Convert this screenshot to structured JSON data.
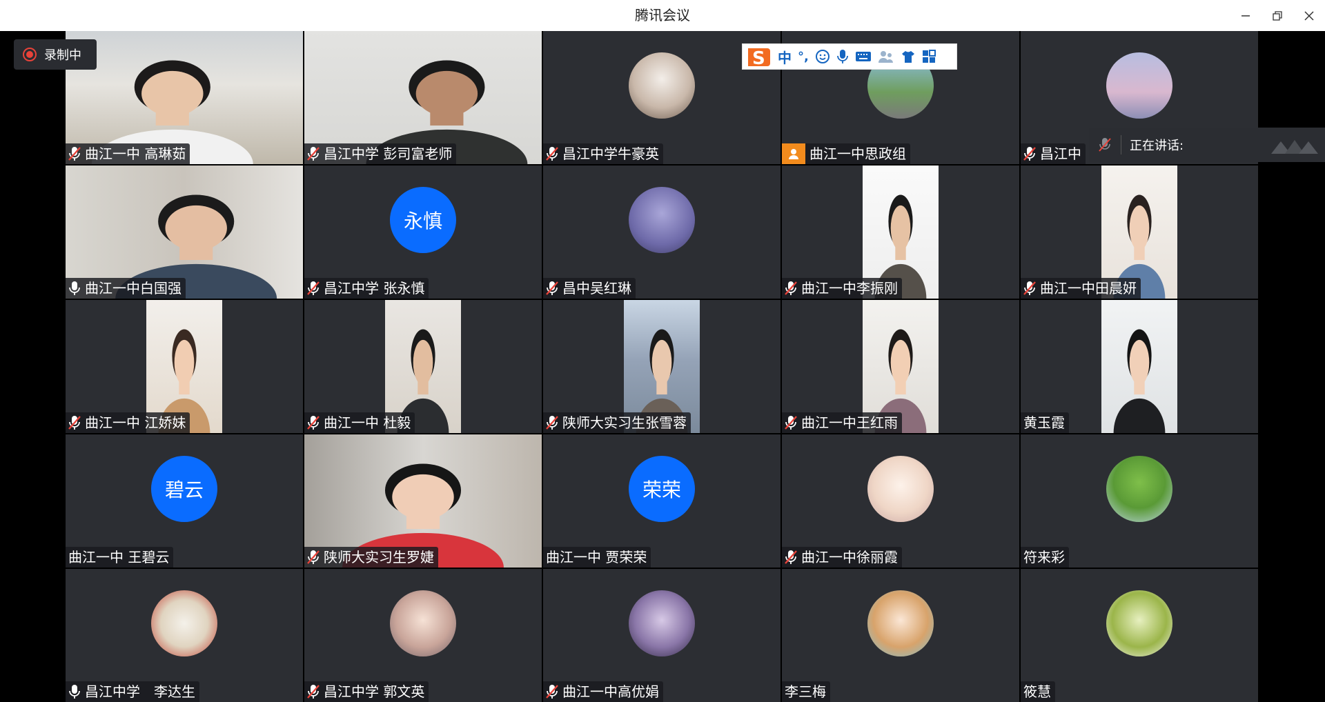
{
  "app": {
    "title": "腾讯会议"
  },
  "recording": {
    "label": "录制中"
  },
  "speaking": {
    "label": "正在讲话:"
  },
  "ime_toolbar": {
    "mode": "中",
    "punct": "°,"
  },
  "colors": {
    "tile_bg": "#2c2e33",
    "avatar_blue": "#0a6cff",
    "rec_red": "#e8433a"
  },
  "participants": [
    {
      "name": "曲江一中 高琳茹",
      "mic": "muted",
      "media": "video"
    },
    {
      "name": "昌江中学 彭司富老师",
      "mic": "muted",
      "media": "video"
    },
    {
      "name": "昌江中学牛豪英",
      "mic": "muted",
      "media": "avatar-image"
    },
    {
      "name": "曲江一中思政组",
      "mic": "person",
      "media": "avatar-image"
    },
    {
      "name": "昌江中",
      "mic": "muted",
      "media": "avatar-image"
    },
    {
      "name": "曲江一中白国强",
      "mic": "on",
      "media": "video"
    },
    {
      "name": "昌江中学 张永慎",
      "mic": "muted",
      "media": "avatar-text",
      "avatar_text": "永慎"
    },
    {
      "name": "昌中吴红琳",
      "mic": "muted",
      "media": "avatar-image"
    },
    {
      "name": "曲江一中李振刚",
      "mic": "muted",
      "media": "video"
    },
    {
      "name": "曲江一中田晨妍",
      "mic": "muted",
      "media": "video"
    },
    {
      "name": "曲江一中 江娇妹",
      "mic": "muted",
      "media": "video"
    },
    {
      "name": "曲江一中 杜毅",
      "mic": "muted",
      "media": "video"
    },
    {
      "name": "陕师大实习生张雪蓉",
      "mic": "muted",
      "media": "video"
    },
    {
      "name": "曲江一中王红雨",
      "mic": "muted",
      "media": "video"
    },
    {
      "name": "黄玉霞",
      "mic": "none",
      "media": "video"
    },
    {
      "name": "曲江一中 王碧云",
      "mic": "none",
      "media": "avatar-text",
      "avatar_text": "碧云"
    },
    {
      "name": "陕师大实习生罗婕",
      "mic": "muted",
      "media": "video"
    },
    {
      "name": "曲江一中 贾荣荣",
      "mic": "none",
      "media": "avatar-text",
      "avatar_text": "荣荣"
    },
    {
      "name": "曲江一中徐丽霞",
      "mic": "muted",
      "media": "avatar-image"
    },
    {
      "name": "符来彩",
      "mic": "none",
      "media": "avatar-image"
    },
    {
      "name": "昌江中学　李达生",
      "mic": "on",
      "media": "avatar-image"
    },
    {
      "name": "昌江中学 郭文英",
      "mic": "muted",
      "media": "avatar-image"
    },
    {
      "name": "曲江一中高优娟",
      "mic": "muted",
      "media": "avatar-image"
    },
    {
      "name": "李三梅",
      "mic": "none",
      "media": "avatar-image"
    },
    {
      "name": "筱慧",
      "mic": "none",
      "media": "avatar-image"
    }
  ]
}
